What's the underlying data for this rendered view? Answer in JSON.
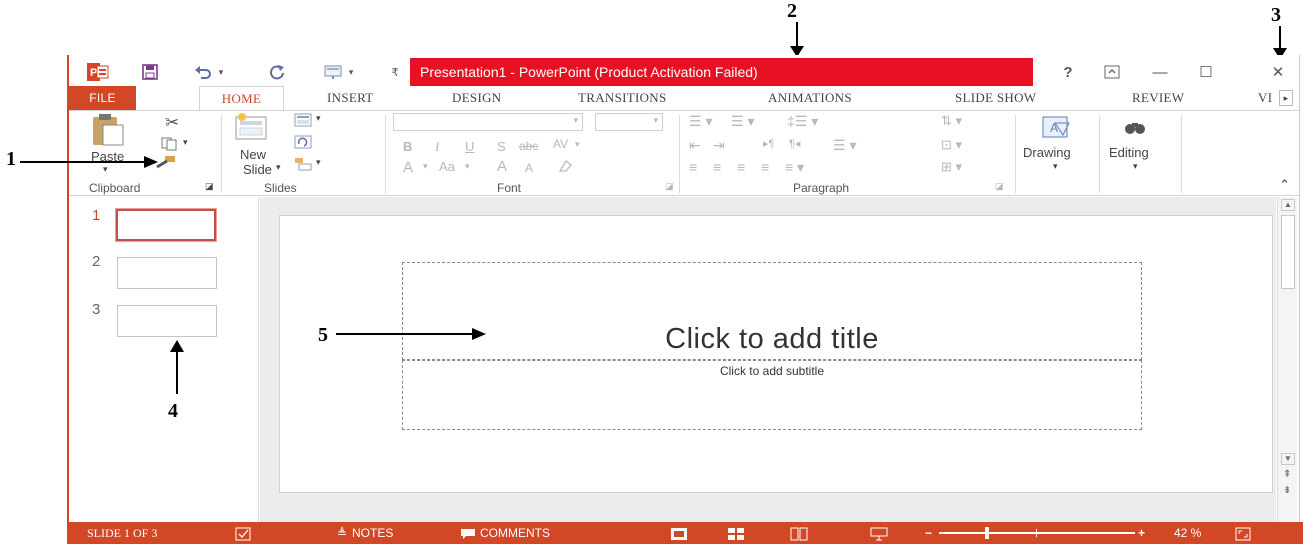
{
  "annotations": [
    "1",
    "2",
    "3",
    "4",
    "5"
  ],
  "qat": {
    "app_icon": "powerpoint-icon",
    "save_icon": "save-icon",
    "undo_icon": "undo-icon",
    "redo_icon": "redo-icon",
    "start_icon": "from-beginning-icon",
    "customize_icon": "customize-qat-icon"
  },
  "title_bar": {
    "title": "Presentation1 - PowerPoint (Product Activation Failed)",
    "help": "?",
    "restore_ribbon_icon": "ribbon-display-options-icon",
    "minimize": "—",
    "maximize": "☐",
    "close": "✕"
  },
  "tabs": [
    "FILE",
    "HOME",
    "INSERT",
    "DESIGN",
    "TRANSITIONS",
    "ANIMATIONS",
    "SLIDE SHOW",
    "REVIEW",
    "VI"
  ],
  "ribbon": {
    "clipboard": {
      "paste": "Paste",
      "label": "Clipboard"
    },
    "slides": {
      "new_slide_line1": "New",
      "new_slide_line2": "Slide",
      "label": "Slides"
    },
    "font": {
      "bold": "B",
      "italic": "I",
      "underline": "U",
      "strike": "S",
      "abc": "abc",
      "spacing": "AV",
      "font_color": "A",
      "change_case": "Aa",
      "grow": "A",
      "shrink": "A",
      "label": "Font"
    },
    "paragraph": {
      "label": "Paragraph"
    },
    "drawing": {
      "label": "Drawing"
    },
    "editing": {
      "label": "Editing"
    }
  },
  "slides_pane": {
    "thumbnails": [
      {
        "number": "1",
        "selected": true
      },
      {
        "number": "2",
        "selected": false
      },
      {
        "number": "3",
        "selected": false
      }
    ]
  },
  "slide": {
    "title_placeholder": "Click to add title",
    "subtitle_placeholder": "Click to add subtitle"
  },
  "status_bar": {
    "slide_indicator": "SLIDE 1 OF 3",
    "notes": "NOTES",
    "comments": "COMMENTS",
    "zoom_minus": "−",
    "zoom_plus": "+",
    "zoom": "42 %",
    "zoom_level": 0.42
  },
  "colors": {
    "accent": "#d24726",
    "title_highlight": "#e81123"
  }
}
